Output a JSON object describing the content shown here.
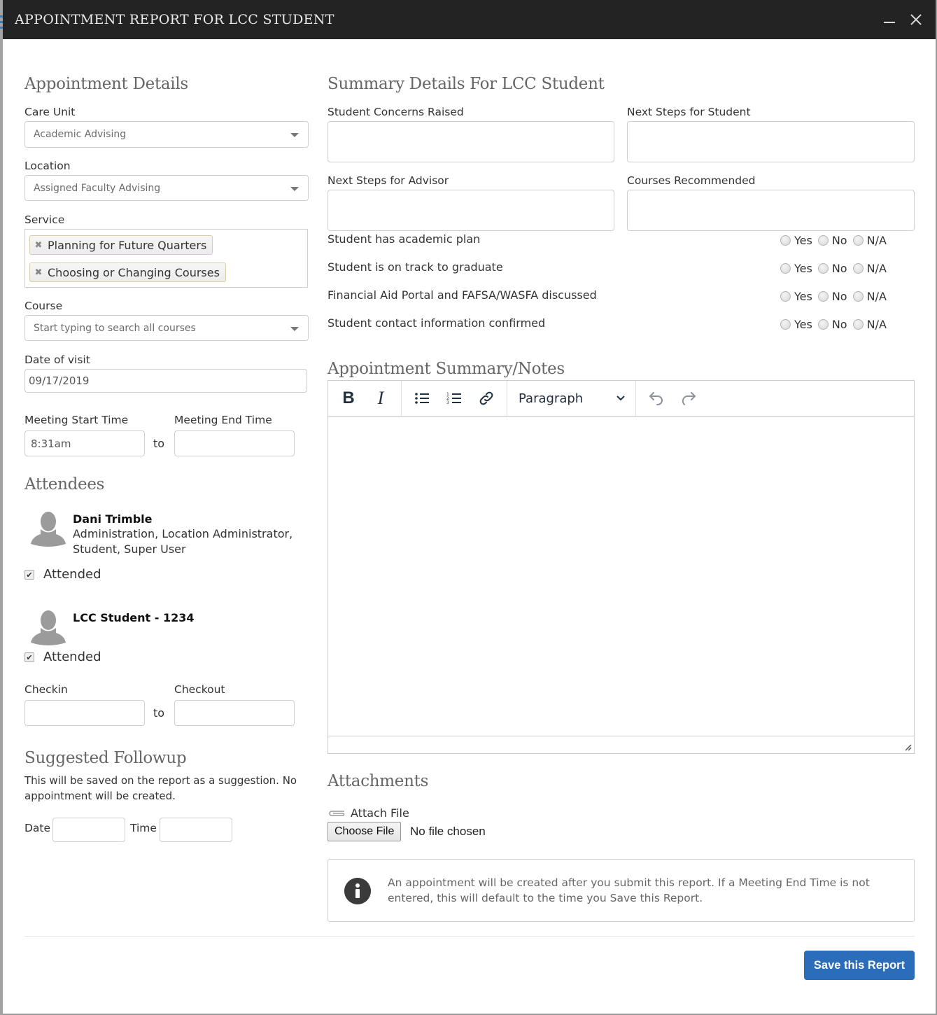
{
  "window": {
    "title": "APPOINTMENT REPORT FOR LCC STUDENT",
    "minimize_icon": "minimize-icon",
    "close_icon": "close-icon"
  },
  "appointment_details": {
    "heading": "Appointment Details",
    "care_unit": {
      "label": "Care Unit",
      "value": "Academic Advising"
    },
    "location": {
      "label": "Location",
      "value": "Assigned Faculty Advising"
    },
    "service": {
      "label": "Service",
      "tags": [
        "Planning for Future Quarters",
        "Choosing or Changing Courses"
      ],
      "remove_glyph": "✖"
    },
    "course": {
      "label": "Course",
      "placeholder": "Start typing to search all courses"
    },
    "date_of_visit": {
      "label": "Date of visit",
      "value": "09/17/2019"
    },
    "meeting": {
      "start_label": "Meeting Start Time",
      "start_value": "8:31am",
      "to": "to",
      "end_label": "Meeting End Time",
      "end_value": ""
    }
  },
  "attendees": {
    "heading": "Attendees",
    "list": [
      {
        "name": "Dani Trimble",
        "roles": "Administration, Location Administrator, Student, Super User",
        "attended_label": "Attended",
        "attended": true
      },
      {
        "name": "LCC Student - 1234",
        "roles": "",
        "attended_label": "Attended",
        "attended": true
      }
    ],
    "checkin": {
      "label": "Checkin",
      "value": "",
      "to": "to"
    },
    "checkout": {
      "label": "Checkout",
      "value": ""
    }
  },
  "followup": {
    "heading": "Suggested Followup",
    "help": "This will be saved on the report as a suggestion. No appointment will be created.",
    "date_label": "Date",
    "date_value": "",
    "time_label": "Time",
    "time_value": ""
  },
  "summary": {
    "heading": "Summary Details For LCC Student",
    "fields": {
      "student_concerns": {
        "label": "Student Concerns Raised",
        "value": ""
      },
      "next_steps_student": {
        "label": "Next Steps for Student",
        "value": ""
      },
      "next_steps_advisor": {
        "label": "Next Steps for Advisor",
        "value": ""
      },
      "courses_recommended": {
        "label": "Courses Recommended",
        "value": ""
      }
    },
    "questions": [
      {
        "label": "Student has academic plan",
        "options": [
          "Yes",
          "No",
          "N/A"
        ],
        "selected": null
      },
      {
        "label": "Student is on track to graduate",
        "options": [
          "Yes",
          "No",
          "N/A"
        ],
        "selected": null
      },
      {
        "label": "Financial Aid Portal and FAFSA/WASFA discussed",
        "options": [
          "Yes",
          "No",
          "N/A"
        ],
        "selected": null
      },
      {
        "label": "Student contact information confirmed",
        "options": [
          "Yes",
          "No",
          "N/A"
        ],
        "selected": null
      }
    ]
  },
  "notes": {
    "heading": "Appointment Summary/Notes",
    "toolbar": {
      "bold": "B",
      "italic": "I",
      "block_format": "Paragraph"
    },
    "content": ""
  },
  "attachments": {
    "heading": "Attachments",
    "attach_label": "Attach File",
    "choose_button": "Choose File",
    "file_status": "No file chosen"
  },
  "info": {
    "message": "An appointment will be created after you submit this report. If a Meeting End Time is not entered, this will default to the time you Save this Report."
  },
  "actions": {
    "save_label": "Save this Report",
    "save_color": "#2b6db8"
  }
}
